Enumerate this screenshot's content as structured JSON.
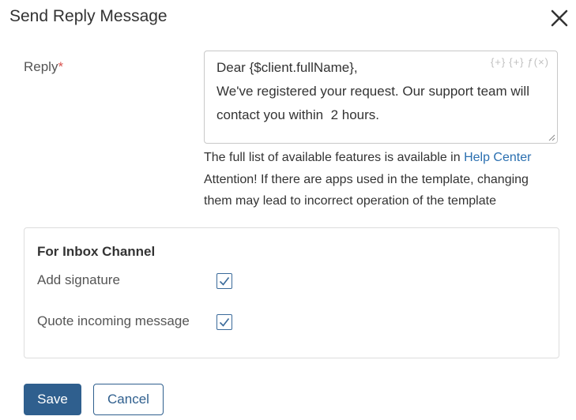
{
  "dialog": {
    "title": "Send Reply Message"
  },
  "reply": {
    "label": "Reply",
    "required_mark": "*",
    "lines": [
      "Dear {$client.fullName},",
      "We've registered your request. Our support team will",
      "contact you within  2 hours."
    ],
    "tools": {
      "insert_variable": "{+}",
      "insert_app": "{+}",
      "insert_function": "ƒ(×)"
    }
  },
  "help": {
    "line1_prefix": "The full list of available features is available in ",
    "link_label": "Help Center",
    "line2": "Attention! If there are apps used in the template, changing",
    "line3": "them may lead to incorrect operation of the template"
  },
  "inbox_panel": {
    "title": "For Inbox Channel",
    "options": [
      {
        "label": "Add signature",
        "checked": true
      },
      {
        "label": "Quote incoming message",
        "checked": true
      }
    ]
  },
  "buttons": {
    "save_label": "Save",
    "cancel_label": "Cancel"
  },
  "colors": {
    "primary": "#2f5f8e",
    "link": "#2a6fb0",
    "required": "#d9534f"
  }
}
